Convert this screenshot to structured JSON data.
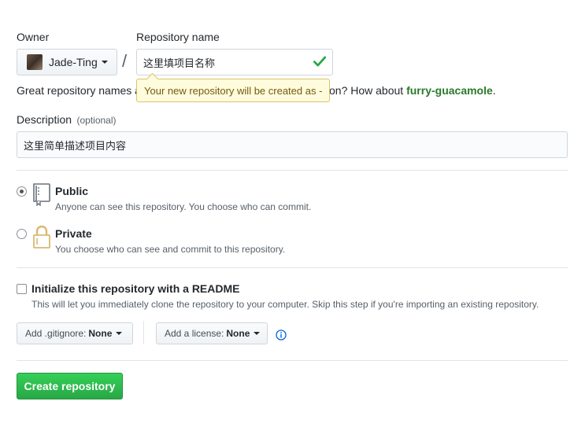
{
  "owner": {
    "label": "Owner",
    "value": "Jade-Ting"
  },
  "separator": "/",
  "repo_name": {
    "label": "Repository name",
    "value": "这里填项目名称",
    "tooltip": "Your new repository will be created as -"
  },
  "hint": {
    "prefix": "Great repository names a",
    "suffix": "on? How about ",
    "suggestion": "furry-guacamole",
    "end": "."
  },
  "description": {
    "label": "Description",
    "optional": "(optional)",
    "value": "这里简单描述项目内容"
  },
  "visibility": {
    "public": {
      "title": "Public",
      "subtitle": "Anyone can see this repository. You choose who can commit.",
      "selected": true
    },
    "private": {
      "title": "Private",
      "subtitle": "You choose who can see and commit to this repository.",
      "selected": false
    }
  },
  "readme": {
    "title": "Initialize this repository with a README",
    "subtitle": "This will let you immediately clone the repository to your computer. Skip this step if you're importing an existing repository.",
    "checked": false
  },
  "gitignore": {
    "label": "Add .gitignore:",
    "value": "None"
  },
  "license": {
    "label": "Add a license:",
    "value": "None"
  },
  "create_button": "Create repository",
  "icons": {
    "check": "check-icon",
    "repo": "repo-book-icon",
    "lock": "lock-icon",
    "info": "info-icon"
  },
  "colors": {
    "valid_check": "#28a745",
    "suggestion": "#2a7a2a",
    "primary_button": "#28a745",
    "tooltip_bg": "#fffbdd",
    "info_icon": "#0366d6"
  }
}
